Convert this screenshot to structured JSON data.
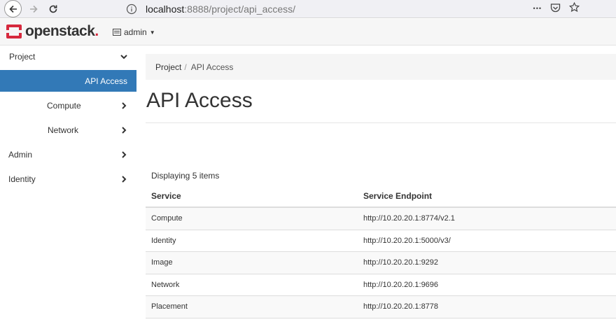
{
  "browser": {
    "url_host": "localhost",
    "url_path": ":8888/project/api_access/",
    "menu_dots": "•••"
  },
  "header": {
    "logo_text": "openstack",
    "logo_dot": ".",
    "project_menu_label": "admin"
  },
  "sidebar": {
    "items": [
      {
        "label": "Project"
      },
      {
        "label": "API Access"
      },
      {
        "label": "Compute"
      },
      {
        "label": "Network"
      },
      {
        "label": "Admin"
      },
      {
        "label": "Identity"
      }
    ]
  },
  "breadcrumb": {
    "root": "Project",
    "separator": "/",
    "current": "API Access"
  },
  "page": {
    "title": "API Access",
    "item_count": "Displaying 5 items"
  },
  "table": {
    "headers": {
      "service": "Service",
      "endpoint": "Service Endpoint"
    },
    "rows": [
      {
        "service": "Compute",
        "endpoint": "http://10.20.20.1:8774/v2.1"
      },
      {
        "service": "Identity",
        "endpoint": "http://10.20.20.1:5000/v3/"
      },
      {
        "service": "Image",
        "endpoint": "http://10.20.20.1:9292"
      },
      {
        "service": "Network",
        "endpoint": "http://10.20.20.1:9696"
      },
      {
        "service": "Placement",
        "endpoint": "http://10.20.20.1:8778"
      }
    ]
  },
  "colors": {
    "active_sidebar": "#3279b7",
    "logo_accent": "#d6293d"
  },
  "icons": {
    "back": "back-arrow-icon",
    "forward": "forward-arrow-icon",
    "reload": "reload-icon",
    "info": "info-icon",
    "pocket": "pocket-icon",
    "bookmark": "star-icon",
    "chevron": "chevron-icon"
  }
}
